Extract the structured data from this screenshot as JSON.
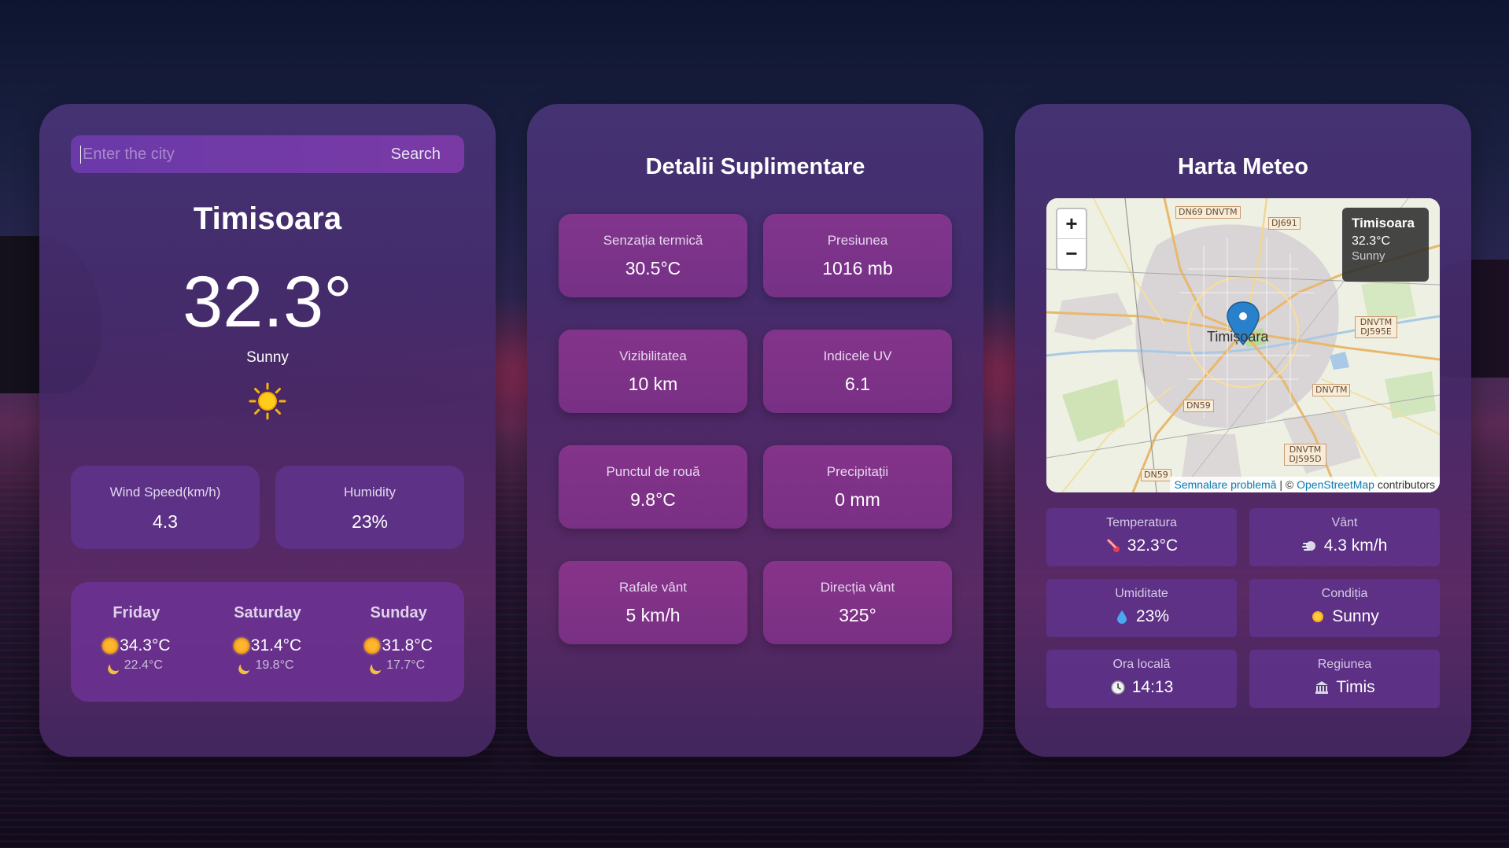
{
  "search": {
    "placeholder": "Enter the city",
    "button_label": "Search"
  },
  "current": {
    "city": "Timisoara",
    "temperature": "32.3°",
    "condition": "Sunny",
    "condition_icon": "sun-icon",
    "wind_label": "Wind Speed(km/h)",
    "wind_value": "4.3",
    "humidity_label": "Humidity",
    "humidity_value": "23%"
  },
  "forecast": [
    {
      "day": "Friday",
      "high": "34.3°C",
      "low": "22.4°C"
    },
    {
      "day": "Saturday",
      "high": "31.4°C",
      "low": "19.8°C"
    },
    {
      "day": "Sunday",
      "high": "31.8°C",
      "low": "17.7°C"
    }
  ],
  "details": {
    "title": "Detalii Suplimentare",
    "items": [
      {
        "label": "Senzația termică",
        "value": "30.5°C"
      },
      {
        "label": "Presiunea",
        "value": "1016 mb"
      },
      {
        "label": "Vizibilitatea",
        "value": "10 km"
      },
      {
        "label": "Indicele UV",
        "value": "6.1"
      },
      {
        "label": "Punctul de rouă",
        "value": "9.8°C"
      },
      {
        "label": "Precipitații",
        "value": "0 mm"
      },
      {
        "label": "Rafale vânt",
        "value": "5 km/h"
      },
      {
        "label": "Direcția vânt",
        "value": "325°"
      }
    ]
  },
  "map": {
    "title": "Harta Meteo",
    "zoom_in": "+",
    "zoom_out": "−",
    "popup_city": "Timisoara",
    "popup_temp": "32.3°C",
    "popup_condition": "Sunny",
    "city_label": "Timișoara",
    "roads": [
      "DN69 DNVTM",
      "DJ691",
      "DNVTM DJ595E",
      "DNVTM",
      "DN59",
      "DNVTM DJ595D",
      "DN59"
    ],
    "attribution_link1": "Semnalare problemă",
    "attribution_sep": " | © ",
    "attribution_link2": "OpenStreetMap",
    "attribution_tail": " contributors"
  },
  "map_info": [
    {
      "label": "Temperatura",
      "value": "32.3°C",
      "icon": "thermometer-icon"
    },
    {
      "label": "Vânt",
      "value": "4.3 km/h",
      "icon": "wind-icon"
    },
    {
      "label": "Umiditate",
      "value": "23%",
      "icon": "droplet-icon"
    },
    {
      "label": "Condiția",
      "value": "Sunny",
      "icon": "sun-icon"
    },
    {
      "label": "Ora locală",
      "value": "14:13",
      "icon": "clock-icon"
    },
    {
      "label": "Regiunea",
      "value": "Timis",
      "icon": "bank-icon"
    }
  ],
  "colors": {
    "accent": "#7a3aa6",
    "card": "#4a3478",
    "detail": "#9a3796"
  }
}
